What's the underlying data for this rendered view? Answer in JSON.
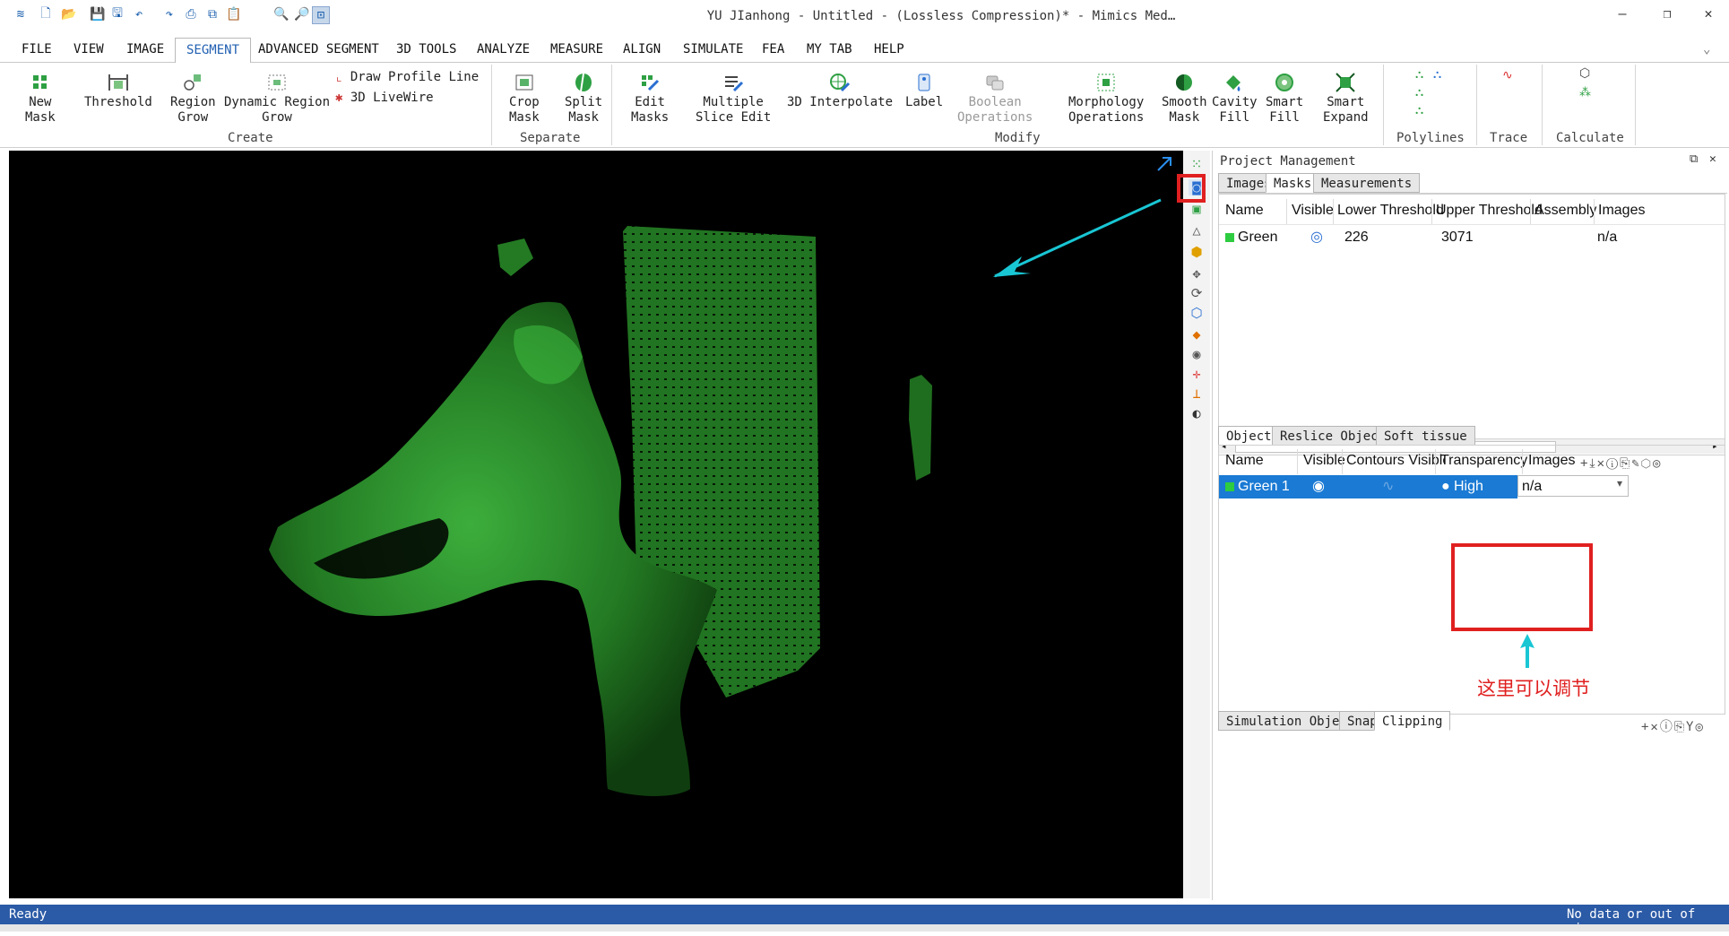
{
  "app": {
    "title": "YU JIanhong - Untitled -  (Lossless Compression)* - Mimics Med…",
    "quick_access_icons": [
      "app-icon",
      "new-file-icon",
      "open-folder-icon",
      "save-icon",
      "save-all-icon",
      "undo-icon",
      "redo-icon",
      "print-icon",
      "copy-icon",
      "paste-icon",
      "zoom-in-icon",
      "zoom-out-icon",
      "zoom-fit-icon"
    ],
    "window_controls": [
      "–",
      "❐",
      "✕"
    ]
  },
  "menu": {
    "items": [
      "FILE",
      "VIEW",
      "IMAGE",
      "SEGMENT",
      "ADVANCED SEGMENT",
      "3D TOOLS",
      "ANALYZE",
      "MEASURE",
      "ALIGN",
      "SIMULATE",
      "FEA",
      "MY TAB",
      "HELP"
    ],
    "active": "SEGMENT"
  },
  "ribbon": {
    "new_mask": [
      "New",
      "Mask"
    ],
    "threshold": "Threshold",
    "region_grow": [
      "Region",
      "Grow"
    ],
    "dynamic_region_grow": [
      "Dynamic Region",
      "Grow"
    ],
    "draw_profile_line": "Draw Profile Line",
    "livewire": "3D LiveWire",
    "group_create": "Create",
    "crop_mask": [
      "Crop",
      "Mask"
    ],
    "split_mask": [
      "Split",
      "Mask"
    ],
    "group_separate": "Separate",
    "edit_masks": [
      "Edit",
      "Masks"
    ],
    "multiple_slice_edit": [
      "Multiple",
      "Slice Edit"
    ],
    "interpolate_3d": "3D Interpolate",
    "label": "Label",
    "boolean_ops": [
      "Boolean",
      "Operations"
    ],
    "morphology_ops": [
      "Morphology",
      "Operations"
    ],
    "group_modify": "Modify",
    "smooth_mask": [
      "Smooth",
      "Mask"
    ],
    "cavity_fill": [
      "Cavity",
      "Fill"
    ],
    "smart_fill": [
      "Smart",
      "Fill"
    ],
    "smart_expand": [
      "Smart",
      "Expand"
    ],
    "polylines": "Polylines",
    "trace": "Trace",
    "calculate": "Calculate"
  },
  "project_management": {
    "title": "Project Management",
    "top_tabs": [
      "Images",
      "Masks",
      "Measurements"
    ],
    "active_top_tab": "Masks",
    "mask_columns": [
      "Name",
      "Visible",
      "Lower Threshold",
      "Upper Threshold",
      "Assembly",
      "Images"
    ],
    "mask_rows": [
      {
        "name": "Green",
        "color": "#2ecc40",
        "lower": "226",
        "upper": "3071",
        "images": "n/a"
      }
    ],
    "object_tabs": [
      "Objects",
      "Reslice Objects",
      "Soft tissue"
    ],
    "active_object_tab": "Objects",
    "object_columns": [
      "Name",
      "Visible",
      "Contours Visible",
      "Transparency",
      "Images"
    ],
    "object_rows": [
      {
        "name": "Green 1",
        "color": "#2ecc40",
        "transparency": "High",
        "images": "n/a"
      }
    ],
    "bottom_tabs": [
      "Simulation Objects",
      "Snap",
      "Clipping"
    ],
    "active_bottom_tab": "Clipping"
  },
  "annotation": {
    "note": "这里可以调节",
    "highlight_color": "#e02020",
    "arrow_color": "#19c6d4"
  },
  "status": {
    "left": "Ready",
    "right": "No data or out of view"
  }
}
